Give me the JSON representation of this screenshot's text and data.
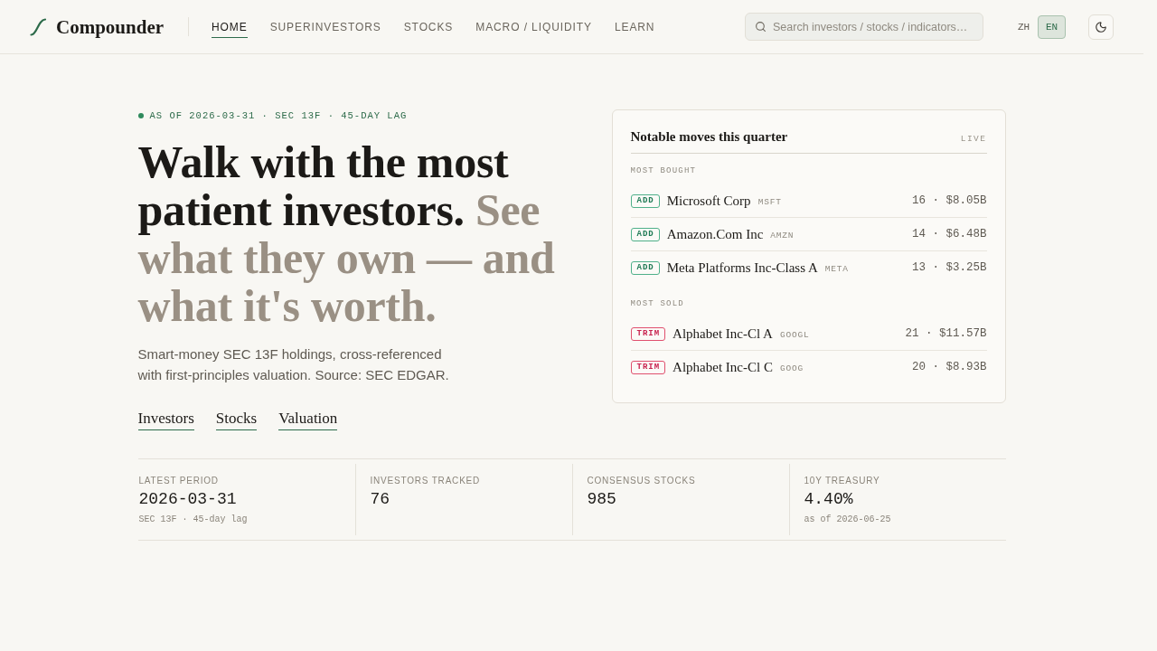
{
  "header": {
    "logo": "Compounder",
    "nav": [
      {
        "label": "HOME",
        "selected": true
      },
      {
        "label": "SUPERINVESTORS",
        "selected": false
      },
      {
        "label": "STOCKS",
        "selected": false
      },
      {
        "label": "MACRO / LIQUIDITY",
        "selected": false
      },
      {
        "label": "LEARN",
        "selected": false
      }
    ],
    "search": {
      "placeholder": "Search investors / stocks / indicators…"
    },
    "languages": [
      {
        "label": "ZH",
        "selected": false
      },
      {
        "label": "EN",
        "selected": true
      }
    ]
  },
  "hero": {
    "eyebrow": "AS OF 2026-03-31 · SEC 13F · 45-DAY LAG",
    "headline": "Walk with the most patient investors.",
    "headline_muted": "See what they own — and what it's worth.",
    "description": "Smart-money SEC 13F holdings, cross-referenced with first-principles valuation. Source: SEC EDGAR.",
    "links": [
      "Investors",
      "Stocks",
      "Valuation"
    ]
  },
  "moves_card": {
    "title": "Notable moves this quarter",
    "status": "LIVE",
    "sections": [
      {
        "heading": "MOST BOUGHT",
        "rows": [
          {
            "kind": "add",
            "tag": "ADD",
            "name": "Microsoft Corp",
            "ticker": "MSFT",
            "figures": "16 · $8.05B"
          },
          {
            "kind": "add",
            "tag": "ADD",
            "name": "Amazon.Com Inc",
            "ticker": "AMZN",
            "figures": "14 · $6.48B"
          },
          {
            "kind": "add",
            "tag": "ADD",
            "name": "Meta Platforms Inc-Class A",
            "ticker": "META",
            "figures": "13 · $3.25B"
          }
        ]
      },
      {
        "heading": "MOST SOLD",
        "rows": [
          {
            "kind": "trim",
            "tag": "TRIM",
            "name": "Alphabet Inc-Cl A",
            "ticker": "GOOGL",
            "figures": "21 · $11.57B"
          },
          {
            "kind": "trim",
            "tag": "TRIM",
            "name": "Alphabet Inc-Cl C",
            "ticker": "GOOG",
            "figures": "20 · $8.93B"
          }
        ]
      }
    ]
  },
  "stats": [
    {
      "label": "LATEST PERIOD",
      "value": "2026-03-31",
      "note": "SEC 13F · 45-day lag"
    },
    {
      "label": "INVESTORS TRACKED",
      "value": "76"
    },
    {
      "label": "CONSENSUS STOCKS",
      "value": "985"
    },
    {
      "label": "10Y TREASURY",
      "value": "4.40%",
      "note": "as of 2026-06-25"
    }
  ]
}
